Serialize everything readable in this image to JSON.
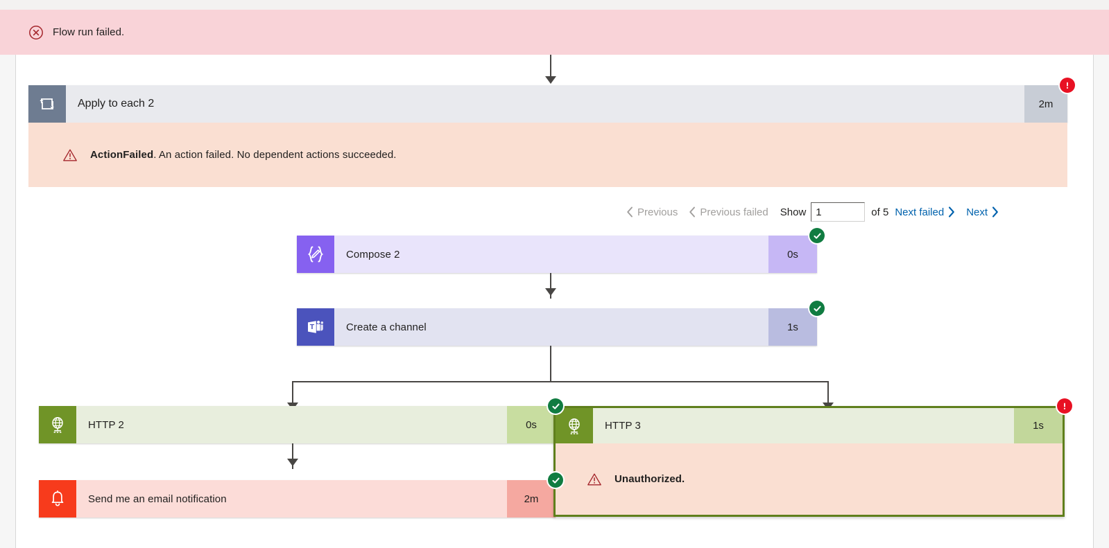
{
  "top_strip": {
    "crumb_left": "",
    "crumb_mid": "",
    "crumb_right": ""
  },
  "banner": {
    "icon": "error-circle-x-icon",
    "text": "Flow run failed.",
    "background": "#f9d3d8",
    "icon_color": "#a4262c"
  },
  "scope": {
    "icon": "loop-repeat-icon",
    "title": "Apply to each 2",
    "duration": "2m",
    "status": "failed",
    "status_badge_icon": "exclamation-icon",
    "header_bg": "#e9eaee",
    "icon_bg": "#6e7c91",
    "duration_bg": "#c8cdd6",
    "error": {
      "icon": "warning-triangle-icon",
      "code": "ActionFailed",
      "message": ". An action failed. No dependent actions succeeded.",
      "background": "#fadfd2"
    }
  },
  "pager": {
    "previous": "Previous",
    "previous_failed": "Previous failed",
    "previous_enabled": false,
    "previous_failed_enabled": false,
    "show_label": "Show",
    "current_page": "1",
    "of_total": "of 5",
    "next_failed": "Next failed",
    "next": "Next",
    "next_failed_enabled": true,
    "next_enabled": true,
    "link_color": "#0062ad",
    "disabled_color": "#a19f9d"
  },
  "actions": {
    "compose": {
      "icon": "compose-braces-pencil-icon",
      "title": "Compose 2",
      "duration": "0s",
      "status": "succeeded",
      "icon_bg": "#8661f0",
      "body_bg": "#e9e4fb",
      "duration_bg": "#c6b7f5"
    },
    "teams": {
      "icon": "microsoft-teams-icon",
      "title": "Create a channel",
      "duration": "1s",
      "status": "succeeded",
      "icon_bg": "#4b53bc",
      "body_bg": "#e2e3f1",
      "duration_bg": "#b9bce0"
    },
    "http2": {
      "icon": "http-globe-icon",
      "title": "HTTP 2",
      "duration": "0s",
      "status": "succeeded",
      "icon_bg": "#709427",
      "body_bg": "#e8eedd",
      "duration_bg": "#c8ddа0"
    },
    "email": {
      "icon": "notification-bell-icon",
      "title": "Send me an email notification",
      "duration": "2m",
      "status": "succeeded",
      "icon_bg": "#f73b1c",
      "body_bg": "#fcdcd8",
      "duration_bg": "#f5a8a0"
    },
    "http3": {
      "icon": "http-globe-icon",
      "title": "HTTP 3",
      "duration": "1s",
      "status": "failed",
      "selected": true,
      "icon_bg": "#709427",
      "body_bg": "#e8eedd",
      "duration_bg": "#c2d79b",
      "selection_border": "#5f7f1c",
      "error": {
        "icon": "warning-triangle-icon",
        "message": "Unauthorized.",
        "background": "#fadfd2"
      }
    }
  }
}
